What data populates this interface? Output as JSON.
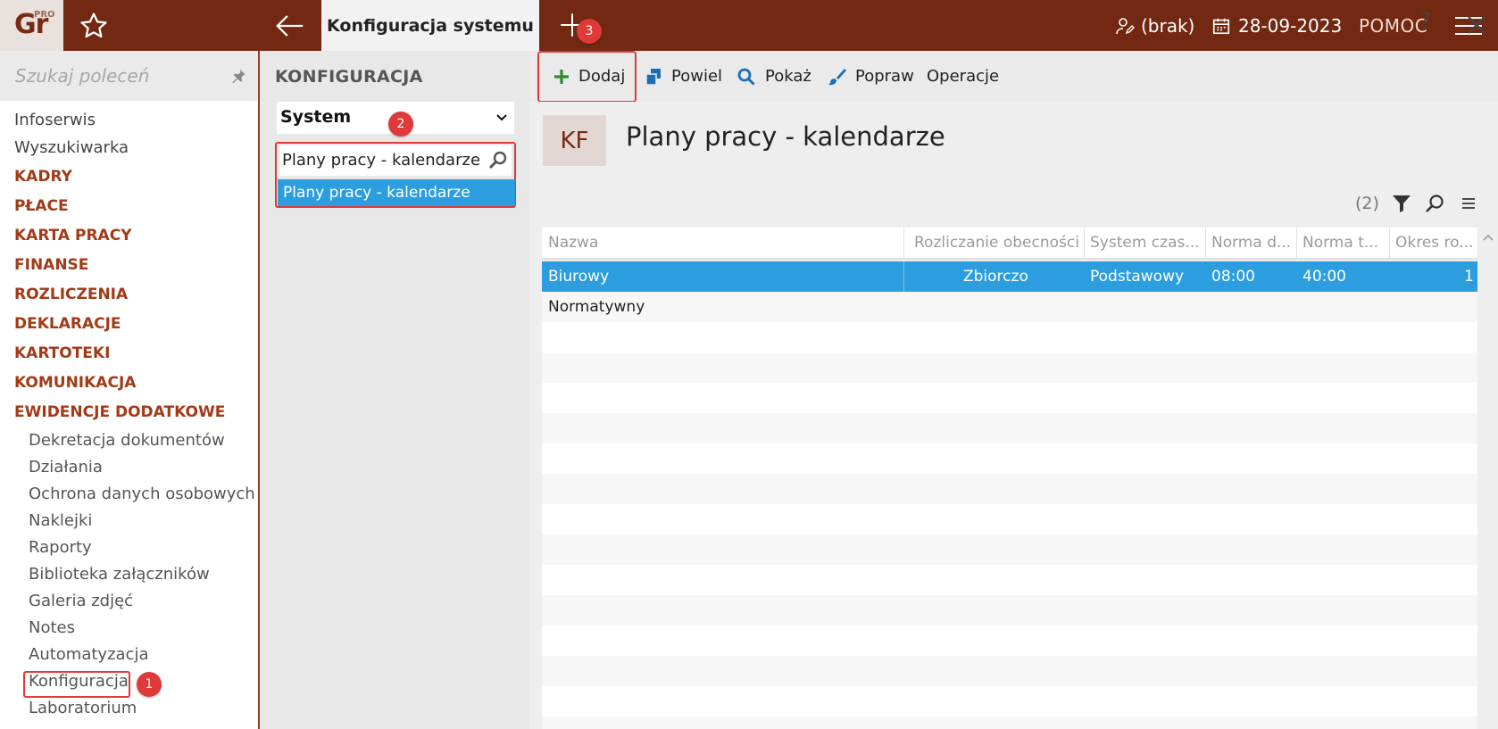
{
  "app": {
    "logo_text": "Gr",
    "logo_sup": "PRO"
  },
  "topbar": {
    "active_tab": "Konfiguracja systemu",
    "user": "(brak)",
    "date": "28-09-2023",
    "help": "POMOC"
  },
  "sidebar": {
    "search_placeholder": "Szukaj poleceń",
    "items": [
      "Infoserwis",
      "Wyszukiwarka"
    ],
    "sections": [
      "KADRY",
      "PŁACE",
      "KARTA PRACY",
      "FINANSE",
      "ROZLICZENIA",
      "DEKLARACJE",
      "KARTOTEKI",
      "KOMUNIKACJA",
      "EWIDENCJE DODATKOWE"
    ],
    "subitems": [
      "Dekretacja dokumentów",
      "Działania",
      "Ochrona danych osobowych",
      "Naklejki",
      "Raporty",
      "Biblioteka załączników",
      "Galeria zdjęć",
      "Notes",
      "Automatyzacja",
      "Konfiguracja",
      "Laboratorium"
    ]
  },
  "config": {
    "title": "KONFIGURACJA",
    "select_value": "System",
    "search_value": "Plany pracy - kalendarze",
    "result": "Plany pracy - kalendarze"
  },
  "toolbar": {
    "add": "Dodaj",
    "duplicate": "Powiel",
    "show": "Pokaż",
    "edit": "Popraw",
    "operations": "Operacje",
    "help": "?"
  },
  "page": {
    "badge": "KF",
    "title": "Plany pracy - kalendarze",
    "count": "(2)"
  },
  "table": {
    "columns": [
      "Nazwa",
      "Rozliczanie obecności",
      "System czas...",
      "Norma d...",
      "Norma t...",
      "Okres ro..."
    ],
    "rows": [
      [
        "Biurowy",
        "Zbiorczo",
        "Podstawowy",
        "08:00",
        "40:00",
        "1"
      ],
      [
        "Normatywny",
        "",
        "",
        "",
        "",
        ""
      ]
    ]
  },
  "badges": [
    "1",
    "2",
    "3"
  ],
  "colors": {
    "brand": "#722811",
    "accent": "#a23a17",
    "selection": "#2c9ee0",
    "highlight": "#e0393a"
  }
}
